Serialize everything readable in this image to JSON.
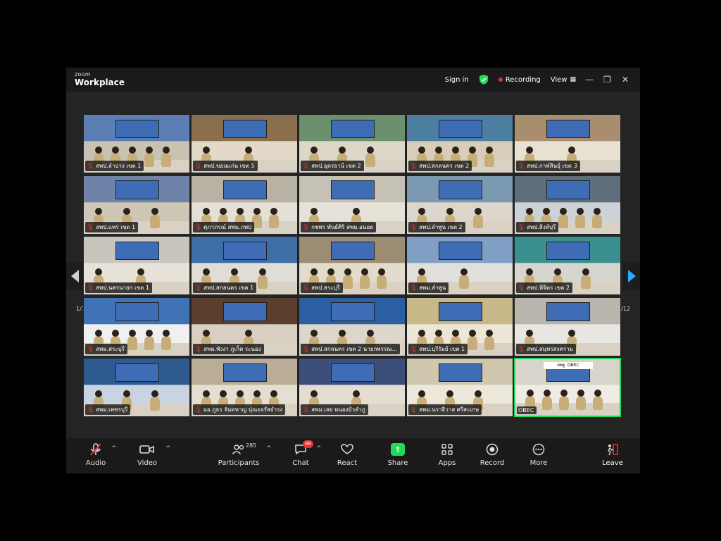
{
  "window": {
    "logo_top": "zoom",
    "logo_bottom": "Workplace",
    "sign_in": "Sign in",
    "recording": "Recording",
    "view": "View",
    "shield_color": "#23d959"
  },
  "pagination": {
    "left": "1/12",
    "right": "1/12"
  },
  "tiles": [
    {
      "label": "สพป.ลำปาง เขต 1"
    },
    {
      "label": "สพป.ขอนแก่น เขต 5"
    },
    {
      "label": "สพป.อุดรธานี เขต 2"
    },
    {
      "label": "สพป.สกลนคร เขต 2"
    },
    {
      "label": "สพป.กาฬสินธุ์ เขต 3"
    },
    {
      "label": "สพป.แพร่ เขต 1"
    },
    {
      "label": "ศุภาภรณ์ สพม.ภพป"
    },
    {
      "label": "กชพร พันธ์ศิริ สพม.อนอด"
    },
    {
      "label": "สพป.ลำพูน เขต 2"
    },
    {
      "label": "สพป.สิงห์บุรี"
    },
    {
      "label": "สพป.นครนายก เขต 1"
    },
    {
      "label": "สพป.สกลนคร เขต 1"
    },
    {
      "label": "สพป.สระบุรี"
    },
    {
      "label": "สพม.ลำพูน"
    },
    {
      "label": "สพป.พิจิตร เขต 2"
    },
    {
      "label": "สพม.สระบุรี"
    },
    {
      "label": "สพม.พังงา ภูเก็ต ระนอง"
    },
    {
      "label": "สพป.สกลนคร เขต 2 นายกพรรณ..."
    },
    {
      "label": "สพป.บุรีรัมย์ เขต 1"
    },
    {
      "label": "สพป.สมุทรสงคราม"
    },
    {
      "label": "สพม.เพชรบุรี"
    },
    {
      "label": "ผอ.ภูธร จันทหาญ ปุณยจรัสธำรง"
    },
    {
      "label": "สพม.เลย หนองบัวลำภู"
    },
    {
      "label": "สพม.นราธิวาส ศรีสะเกษ"
    },
    {
      "label": "OBEC"
    }
  ],
  "toolbar": {
    "audio": "Audio",
    "video": "Video",
    "participants": "Participants",
    "participant_count": "285",
    "chat": "Chat",
    "chat_badge": "86",
    "react": "React",
    "share": "Share",
    "apps": "Apps",
    "record": "Record",
    "more": "More",
    "leave": "Leave",
    "share_color": "#23d959",
    "leave_color": "#e5312f"
  },
  "obec_banner": "สพฐ. OBEC"
}
